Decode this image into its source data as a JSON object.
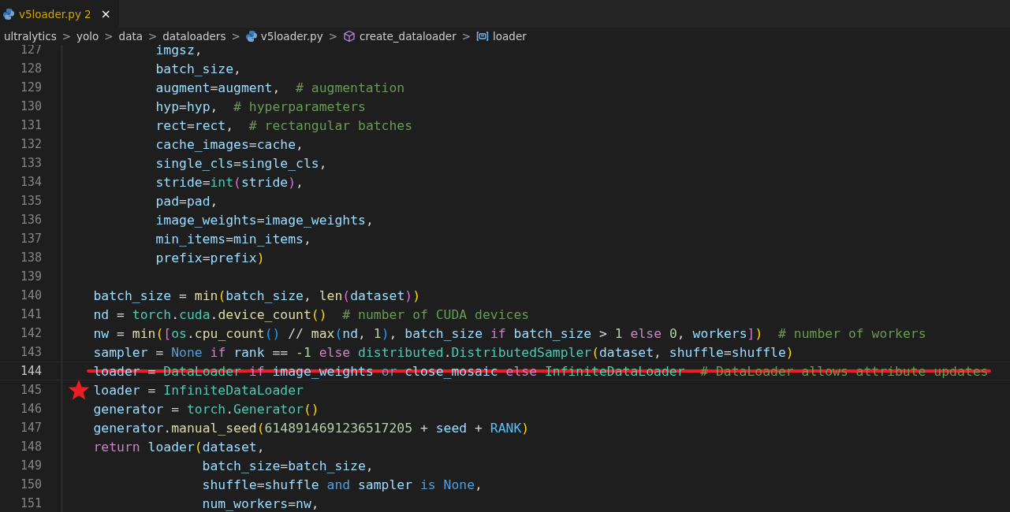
{
  "tabs": [
    {
      "label": "v5loader.py",
      "problems": "2",
      "close": "×",
      "selected": true
    }
  ],
  "breadcrumbs": [
    {
      "text": "ultralytics",
      "kind": "folder"
    },
    {
      "text": "yolo",
      "kind": "folder"
    },
    {
      "text": "data",
      "kind": "folder"
    },
    {
      "text": "dataloaders",
      "kind": "folder"
    },
    {
      "text": "v5loader.py",
      "kind": "file"
    },
    {
      "text": "create_dataloader",
      "kind": "function"
    },
    {
      "text": "loader",
      "kind": "variable"
    }
  ],
  "separator": ">",
  "lines": [
    {
      "number": "127",
      "kind": "argument",
      "tokens": [
        {
          "text": "imgsz",
          "kind": "var"
        },
        {
          "text": ",",
          "kind": "plain"
        }
      ]
    },
    {
      "number": "128",
      "kind": "argument",
      "tokens": [
        {
          "text": "batch_size",
          "kind": "var"
        },
        {
          "text": ",",
          "kind": "plain"
        }
      ]
    },
    {
      "number": "129",
      "kind": "argument",
      "tokens": [
        {
          "text": "augment",
          "kind": "var"
        },
        {
          "text": "=",
          "kind": "plain"
        },
        {
          "text": "augment",
          "kind": "var"
        },
        {
          "text": ",  ",
          "kind": "plain"
        },
        {
          "text": "# augmentation",
          "kind": "comment"
        }
      ]
    },
    {
      "number": "130",
      "kind": "argument",
      "tokens": [
        {
          "text": "hyp",
          "kind": "var"
        },
        {
          "text": "=",
          "kind": "plain"
        },
        {
          "text": "hyp",
          "kind": "var"
        },
        {
          "text": ",  ",
          "kind": "plain"
        },
        {
          "text": "# hyperparameters",
          "kind": "comment"
        }
      ]
    },
    {
      "number": "131",
      "kind": "argument",
      "tokens": [
        {
          "text": "rect",
          "kind": "var"
        },
        {
          "text": "=",
          "kind": "plain"
        },
        {
          "text": "rect",
          "kind": "var"
        },
        {
          "text": ",  ",
          "kind": "plain"
        },
        {
          "text": "# rectangular batches",
          "kind": "comment"
        }
      ]
    },
    {
      "number": "132",
      "kind": "argument",
      "tokens": [
        {
          "text": "cache_images",
          "kind": "var"
        },
        {
          "text": "=",
          "kind": "plain"
        },
        {
          "text": "cache",
          "kind": "var"
        },
        {
          "text": ",",
          "kind": "plain"
        }
      ]
    },
    {
      "number": "133",
      "kind": "argument",
      "tokens": [
        {
          "text": "single_cls",
          "kind": "var"
        },
        {
          "text": "=",
          "kind": "plain"
        },
        {
          "text": "single_cls",
          "kind": "var"
        },
        {
          "text": ",",
          "kind": "plain"
        }
      ]
    },
    {
      "number": "134",
      "kind": "argument",
      "tokens": [
        {
          "text": "stride",
          "kind": "var"
        },
        {
          "text": "=",
          "kind": "plain"
        },
        {
          "text": "int",
          "kind": "type"
        },
        {
          "text": "(",
          "kind": "b2"
        },
        {
          "text": "stride",
          "kind": "var"
        },
        {
          "text": ")",
          "kind": "b2"
        },
        {
          "text": ",",
          "kind": "plain"
        }
      ]
    },
    {
      "number": "135",
      "kind": "argument",
      "tokens": [
        {
          "text": "pad",
          "kind": "var"
        },
        {
          "text": "=",
          "kind": "plain"
        },
        {
          "text": "pad",
          "kind": "var"
        },
        {
          "text": ",",
          "kind": "plain"
        }
      ]
    },
    {
      "number": "136",
      "kind": "argument",
      "tokens": [
        {
          "text": "image_weights",
          "kind": "var"
        },
        {
          "text": "=",
          "kind": "plain"
        },
        {
          "text": "image_weights",
          "kind": "var"
        },
        {
          "text": ",",
          "kind": "plain"
        }
      ]
    },
    {
      "number": "137",
      "kind": "argument",
      "tokens": [
        {
          "text": "min_items",
          "kind": "var"
        },
        {
          "text": "=",
          "kind": "plain"
        },
        {
          "text": "min_items",
          "kind": "var"
        },
        {
          "text": ",",
          "kind": "plain"
        }
      ]
    },
    {
      "number": "138",
      "kind": "argument",
      "tokens": [
        {
          "text": "prefix",
          "kind": "var"
        },
        {
          "text": "=",
          "kind": "plain"
        },
        {
          "text": "prefix",
          "kind": "var"
        },
        {
          "text": ")",
          "kind": "b1"
        }
      ]
    },
    {
      "number": "139"
    },
    {
      "number": "140",
      "kind": "statement",
      "tokens": [
        {
          "text": "batch_size",
          "kind": "var"
        },
        {
          "text": " = ",
          "kind": "plain"
        },
        {
          "text": "min",
          "kind": "fn"
        },
        {
          "text": "(",
          "kind": "b1"
        },
        {
          "text": "batch_size",
          "kind": "var"
        },
        {
          "text": ", ",
          "kind": "plain"
        },
        {
          "text": "len",
          "kind": "fn"
        },
        {
          "text": "(",
          "kind": "b2"
        },
        {
          "text": "dataset",
          "kind": "var"
        },
        {
          "text": ")",
          "kind": "b2"
        },
        {
          "text": ")",
          "kind": "b1"
        }
      ]
    },
    {
      "number": "141",
      "kind": "statement",
      "tokens": [
        {
          "text": "nd",
          "kind": "var"
        },
        {
          "text": " = ",
          "kind": "plain"
        },
        {
          "text": "torch",
          "kind": "type"
        },
        {
          "text": ".",
          "kind": "plain"
        },
        {
          "text": "cuda",
          "kind": "type"
        },
        {
          "text": ".",
          "kind": "plain"
        },
        {
          "text": "device_count",
          "kind": "fn"
        },
        {
          "text": "()",
          "kind": "b1"
        },
        {
          "text": "  # number of CUDA devices",
          "kind": "comment"
        }
      ]
    },
    {
      "number": "142",
      "kind": "statement",
      "tokens": [
        {
          "text": "nw",
          "kind": "var"
        },
        {
          "text": " = ",
          "kind": "plain"
        },
        {
          "text": "min",
          "kind": "fn"
        },
        {
          "text": "(",
          "kind": "b1"
        },
        {
          "text": "[",
          "kind": "b2"
        },
        {
          "text": "os",
          "kind": "type"
        },
        {
          "text": ".",
          "kind": "plain"
        },
        {
          "text": "cpu_count",
          "kind": "fn"
        },
        {
          "text": "()",
          "kind": "b3"
        },
        {
          "text": " // ",
          "kind": "plain"
        },
        {
          "text": "max",
          "kind": "fn"
        },
        {
          "text": "(",
          "kind": "b3"
        },
        {
          "text": "nd",
          "kind": "var"
        },
        {
          "text": ", ",
          "kind": "plain"
        },
        {
          "text": "1",
          "kind": "num"
        },
        {
          "text": ")",
          "kind": "b3"
        },
        {
          "text": ", ",
          "kind": "plain"
        },
        {
          "text": "batch_size",
          "kind": "var"
        },
        {
          "text": " if ",
          "kind": "ctrl"
        },
        {
          "text": "batch_size",
          "kind": "var"
        },
        {
          "text": " > ",
          "kind": "plain"
        },
        {
          "text": "1",
          "kind": "num"
        },
        {
          "text": " else ",
          "kind": "ctrl"
        },
        {
          "text": "0",
          "kind": "num"
        },
        {
          "text": ", ",
          "kind": "plain"
        },
        {
          "text": "workers",
          "kind": "var"
        },
        {
          "text": "]",
          "kind": "b2"
        },
        {
          "text": ")",
          "kind": "b1"
        },
        {
          "text": "  # number of workers",
          "kind": "comment"
        }
      ]
    },
    {
      "number": "143",
      "kind": "statement",
      "tokens": [
        {
          "text": "sampler",
          "kind": "var"
        },
        {
          "text": " = ",
          "kind": "plain"
        },
        {
          "text": "None",
          "kind": "kw"
        },
        {
          "text": " if ",
          "kind": "ctrl"
        },
        {
          "text": "rank",
          "kind": "var"
        },
        {
          "text": " == ",
          "kind": "plain"
        },
        {
          "text": "-1",
          "kind": "num"
        },
        {
          "text": " else ",
          "kind": "ctrl"
        },
        {
          "text": "distributed",
          "kind": "type"
        },
        {
          "text": ".",
          "kind": "plain"
        },
        {
          "text": "DistributedSampler",
          "kind": "type"
        },
        {
          "text": "(",
          "kind": "b1"
        },
        {
          "text": "dataset",
          "kind": "var"
        },
        {
          "text": ", ",
          "kind": "plain"
        },
        {
          "text": "shuffle",
          "kind": "var"
        },
        {
          "text": "=",
          "kind": "plain"
        },
        {
          "text": "shuffle",
          "kind": "var"
        },
        {
          "text": ")",
          "kind": "b1"
        }
      ]
    },
    {
      "number": "144",
      "kind": "statement",
      "current": true,
      "struck": true,
      "tokens": [
        {
          "text": "loader",
          "kind": "var"
        },
        {
          "text": " = ",
          "kind": "plain"
        },
        {
          "text": "DataLoader",
          "kind": "type"
        },
        {
          "text": " if ",
          "kind": "ctrl"
        },
        {
          "text": "image_weights",
          "kind": "var"
        },
        {
          "text": " or ",
          "kind": "kw"
        },
        {
          "text": "close_mosaic",
          "kind": "var"
        },
        {
          "text": " else ",
          "kind": "ctrl"
        },
        {
          "text": "InfiniteDataLoader",
          "kind": "type"
        },
        {
          "text": "  # DataLoader allows attribute updates",
          "kind": "comment"
        }
      ]
    },
    {
      "number": "145",
      "kind": "statement",
      "starred": true,
      "tokens": [
        {
          "text": "loader",
          "kind": "var"
        },
        {
          "text": " = ",
          "kind": "plain"
        },
        {
          "text": "InfiniteDataLoader",
          "kind": "type"
        }
      ]
    },
    {
      "number": "146",
      "kind": "statement",
      "tokens": [
        {
          "text": "generator",
          "kind": "var"
        },
        {
          "text": " = ",
          "kind": "plain"
        },
        {
          "text": "torch",
          "kind": "type"
        },
        {
          "text": ".",
          "kind": "plain"
        },
        {
          "text": "Generator",
          "kind": "type"
        },
        {
          "text": "()",
          "kind": "b1"
        }
      ]
    },
    {
      "number": "147",
      "kind": "statement",
      "tokens": [
        {
          "text": "generator",
          "kind": "var"
        },
        {
          "text": ".",
          "kind": "plain"
        },
        {
          "text": "manual_seed",
          "kind": "fn"
        },
        {
          "text": "(",
          "kind": "b1"
        },
        {
          "text": "6148914691236517205",
          "kind": "num"
        },
        {
          "text": " + ",
          "kind": "plain"
        },
        {
          "text": "seed",
          "kind": "var"
        },
        {
          "text": " + ",
          "kind": "plain"
        },
        {
          "text": "RANK",
          "kind": "const"
        },
        {
          "text": ")",
          "kind": "b1"
        }
      ]
    },
    {
      "number": "148",
      "kind": "statement",
      "tokens": [
        {
          "text": "return ",
          "kind": "ctrl"
        },
        {
          "text": "loader",
          "kind": "var"
        },
        {
          "text": "(",
          "kind": "b1"
        },
        {
          "text": "dataset",
          "kind": "var"
        },
        {
          "text": ",",
          "kind": "plain"
        }
      ]
    },
    {
      "number": "149",
      "kind": "call_argument",
      "tokens": [
        {
          "text": "batch_size",
          "kind": "var"
        },
        {
          "text": "=",
          "kind": "plain"
        },
        {
          "text": "batch_size",
          "kind": "var"
        },
        {
          "text": ",",
          "kind": "plain"
        }
      ]
    },
    {
      "number": "150",
      "kind": "call_argument",
      "tokens": [
        {
          "text": "shuffle",
          "kind": "var"
        },
        {
          "text": "=",
          "kind": "plain"
        },
        {
          "text": "shuffle",
          "kind": "var"
        },
        {
          "text": " and ",
          "kind": "kw"
        },
        {
          "text": "sampler",
          "kind": "var"
        },
        {
          "text": " is ",
          "kind": "kw"
        },
        {
          "text": "None",
          "kind": "kw"
        },
        {
          "text": ",",
          "kind": "plain"
        }
      ]
    },
    {
      "number": "151",
      "kind": "call_argument",
      "tokens": [
        {
          "text": "num_workers",
          "kind": "var"
        },
        {
          "text": "=",
          "kind": "plain"
        },
        {
          "text": "nw",
          "kind": "var"
        },
        {
          "text": ",",
          "kind": "plain"
        }
      ]
    }
  ]
}
